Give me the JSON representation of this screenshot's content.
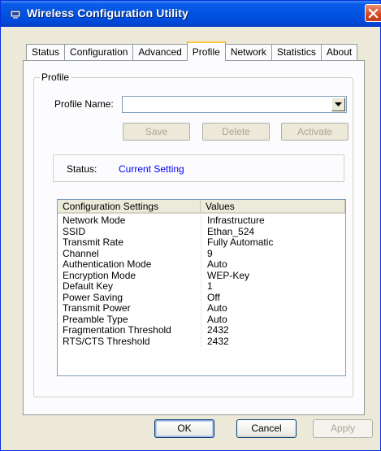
{
  "window": {
    "title": "Wireless Configuration Utility",
    "icon": "network-adapter-icon",
    "close_icon": "close-icon"
  },
  "tabs": [
    {
      "label": "Status",
      "active": false
    },
    {
      "label": "Configuration",
      "active": false
    },
    {
      "label": "Advanced",
      "active": false
    },
    {
      "label": "Profile",
      "active": true
    },
    {
      "label": "Network",
      "active": false
    },
    {
      "label": "Statistics",
      "active": false
    },
    {
      "label": "About",
      "active": false
    }
  ],
  "profile": {
    "group_title": "Profile",
    "name_label": "Profile Name:",
    "name_value": "",
    "buttons": {
      "save": "Save",
      "delete": "Delete",
      "activate": "Activate"
    },
    "status_label": "Status:",
    "status_value": "Current Setting",
    "status_color": "#0000ff"
  },
  "settings_table": {
    "columns": [
      "Configuration Settings",
      "Values"
    ],
    "rows": [
      {
        "setting": "Network Mode",
        "value": "Infrastructure"
      },
      {
        "setting": "SSID",
        "value": "Ethan_524"
      },
      {
        "setting": "Transmit Rate",
        "value": "Fully Automatic"
      },
      {
        "setting": "Channel",
        "value": "9"
      },
      {
        "setting": "Authentication Mode",
        "value": "Auto"
      },
      {
        "setting": "Encryption Mode",
        "value": "WEP-Key"
      },
      {
        "setting": "Default Key",
        "value": "1"
      },
      {
        "setting": "Power Saving",
        "value": "Off"
      },
      {
        "setting": "Transmit Power",
        "value": "Auto"
      },
      {
        "setting": "Preamble Type",
        "value": "Auto"
      },
      {
        "setting": "Fragmentation Threshold",
        "value": "2432"
      },
      {
        "setting": "RTS/CTS Threshold",
        "value": "2432"
      }
    ]
  },
  "footer": {
    "ok": "OK",
    "cancel": "Cancel",
    "apply": "Apply"
  },
  "colors": {
    "titlebar": "#0053e1",
    "dialog_bg": "#ece9d8",
    "active_tab_accent": "#ffc83c"
  }
}
